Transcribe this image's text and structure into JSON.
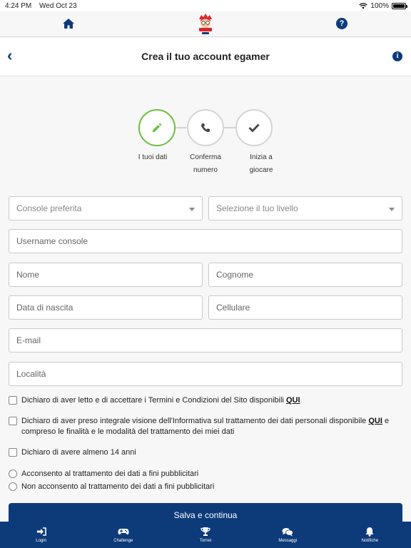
{
  "status_bar": {
    "time": "4:24 PM",
    "date": "Wed Oct 23",
    "battery": "100%"
  },
  "header": {
    "title": "Crea il tuo account egamer"
  },
  "steps": [
    {
      "label": "I tuoi dati"
    },
    {
      "label_line1": "Conferma",
      "label_line2": "numero"
    },
    {
      "label_line1": "Inizia a",
      "label_line2": "giocare"
    }
  ],
  "form": {
    "console_placeholder": "Console preferita",
    "level_placeholder": "Selezione il tuo livello",
    "username_placeholder": "Username console",
    "first_name_placeholder": "Nome",
    "last_name_placeholder": "Cognome",
    "birthdate_placeholder": "Data di nascita",
    "phone_placeholder": "Cellulare",
    "email_placeholder": "E-mail",
    "city_placeholder": "Località"
  },
  "consents": {
    "terms_text": "Dichiaro di aver letto e di accettare i Termini e Condizioni del Sito disponibili ",
    "terms_link": "QUI",
    "privacy_text_1": "Dichiaro di aver preso integrale visione dell'Informativa sul trattamento dei dati personali disponibile ",
    "privacy_link": "QUI",
    "privacy_text_2": " e compreso le finalità e le modalità del trattamento dei miei dati",
    "age_text": "Dichiaro di avere almeno 14 anni",
    "marketing_yes": "Acconsento al trattamento dei dati a fini pubblicitari",
    "marketing_no": "Non acconsento al trattamento dei dati a fini pubblicitari"
  },
  "submit_label": "Salva e continua",
  "tabs": [
    {
      "label": "Login",
      "icon": "login-icon"
    },
    {
      "label": "Challenge",
      "icon": "gamepad-icon"
    },
    {
      "label": "Tornei",
      "icon": "trophy-icon"
    },
    {
      "label": "Messaggi",
      "icon": "chat-icon"
    },
    {
      "label": "Notifiche",
      "icon": "bell-icon"
    }
  ],
  "colors": {
    "primary": "#0d3b7a",
    "active_step": "#6bbf3e",
    "background": "#f7f7f7"
  }
}
